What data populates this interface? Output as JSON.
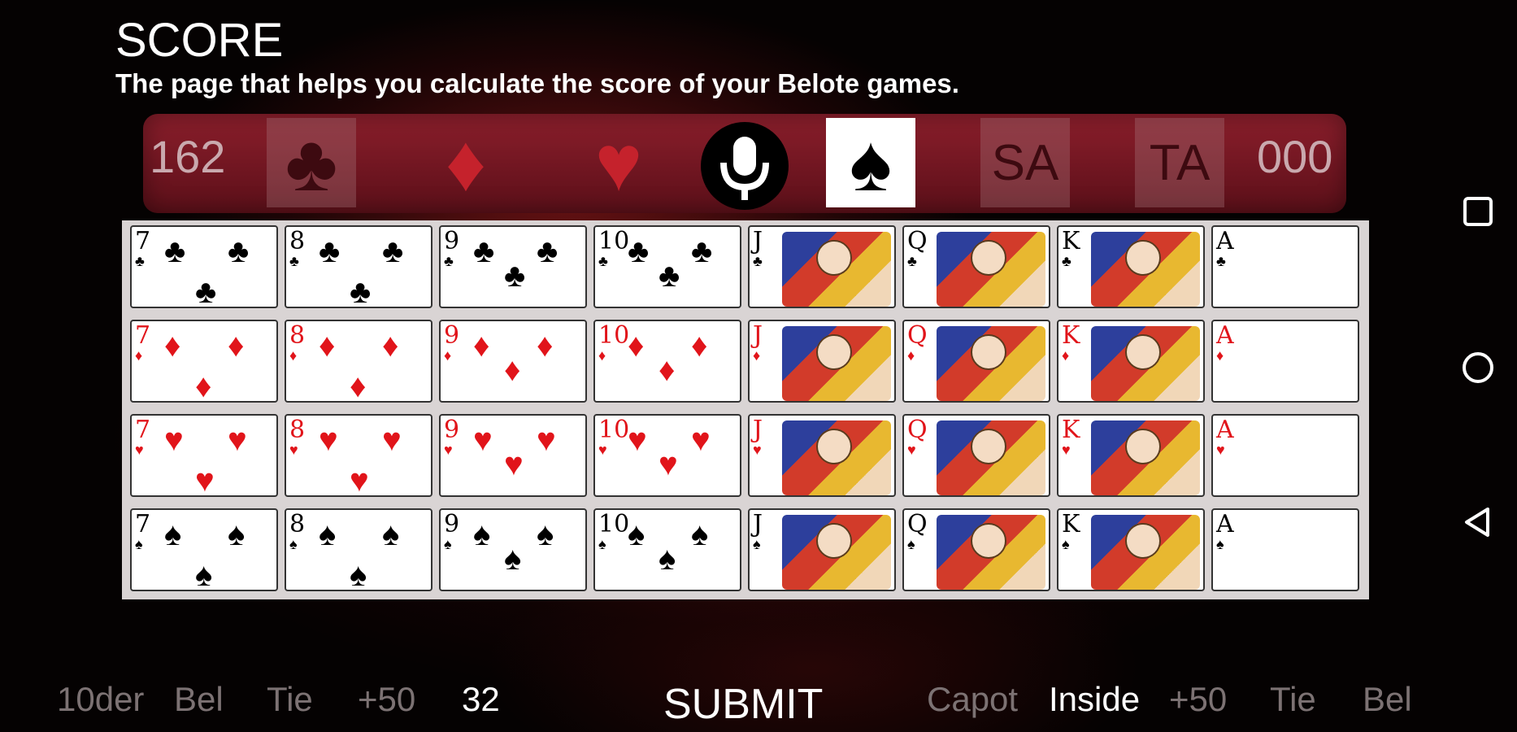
{
  "header": {
    "title": "SCORE",
    "subtitle": "The page that helps you calculate the score of your Belote games."
  },
  "suit_bar": {
    "score_left": "162",
    "score_right": "000",
    "sa_label": "SA",
    "ta_label": "TA",
    "selected_suit": "spades"
  },
  "cards": {
    "rows": [
      {
        "suit": "clubs",
        "symbol": "♣",
        "color": "#000000",
        "ranks": [
          "7",
          "8",
          "9",
          "10",
          "J",
          "Q",
          "K",
          "A"
        ]
      },
      {
        "suit": "diamonds",
        "symbol": "♦",
        "color": "#e1141a",
        "ranks": [
          "7",
          "8",
          "9",
          "10",
          "J",
          "Q",
          "K",
          "A"
        ]
      },
      {
        "suit": "hearts",
        "symbol": "♥",
        "color": "#e1141a",
        "ranks": [
          "7",
          "8",
          "9",
          "10",
          "J",
          "Q",
          "K",
          "A"
        ]
      },
      {
        "suit": "spades",
        "symbol": "♠",
        "color": "#000000",
        "ranks": [
          "7",
          "8",
          "9",
          "10",
          "J",
          "Q",
          "K",
          "A"
        ]
      }
    ]
  },
  "bottom_bar": {
    "left": {
      "tender": "10der",
      "bel": "Bel",
      "tie": "Tie",
      "plus50": "+50",
      "count": "32"
    },
    "submit": "SUBMIT",
    "right": {
      "capot": "Capot",
      "inside": "Inside",
      "plus50": "+50",
      "tie": "Tie",
      "bel": "Bel"
    }
  },
  "nav_bar": {
    "icons": [
      "recent-apps-icon",
      "home-icon",
      "back-icon"
    ]
  }
}
